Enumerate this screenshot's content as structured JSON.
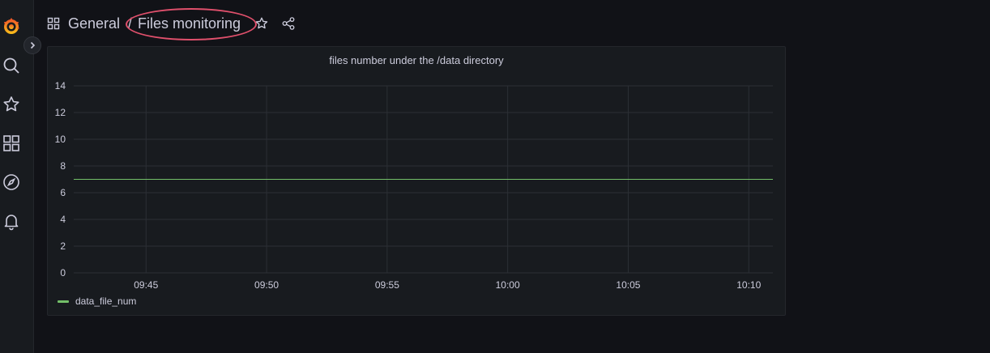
{
  "nav": {
    "items": [
      {
        "name": "grafana-logo-icon"
      },
      {
        "name": "search-icon"
      },
      {
        "name": "star-icon"
      },
      {
        "name": "dashboards-icon"
      },
      {
        "name": "explore-compass-icon"
      },
      {
        "name": "alerting-bell-icon"
      }
    ],
    "expand_icon": "chevron-right-icon"
  },
  "header": {
    "folder": "General",
    "separator": "/",
    "dashboard_title": "Files monitoring",
    "highlight_color": "#e0506c"
  },
  "panel": {
    "title": "files number under the /data directory"
  },
  "chart_data": {
    "type": "line",
    "title": "files number under the /data directory",
    "x": [
      "09:42",
      "10:11"
    ],
    "x_ticks": [
      "09:45",
      "09:50",
      "09:55",
      "10:00",
      "10:05",
      "10:10"
    ],
    "y_ticks": [
      "0",
      "2",
      "4",
      "6",
      "8",
      "10",
      "12",
      "14"
    ],
    "ylim": [
      0,
      14
    ],
    "grid": true,
    "legend": "bottom-left",
    "series": [
      {
        "name": "data_file_num",
        "values": [
          7,
          7
        ],
        "color": "#73bf69"
      }
    ]
  }
}
